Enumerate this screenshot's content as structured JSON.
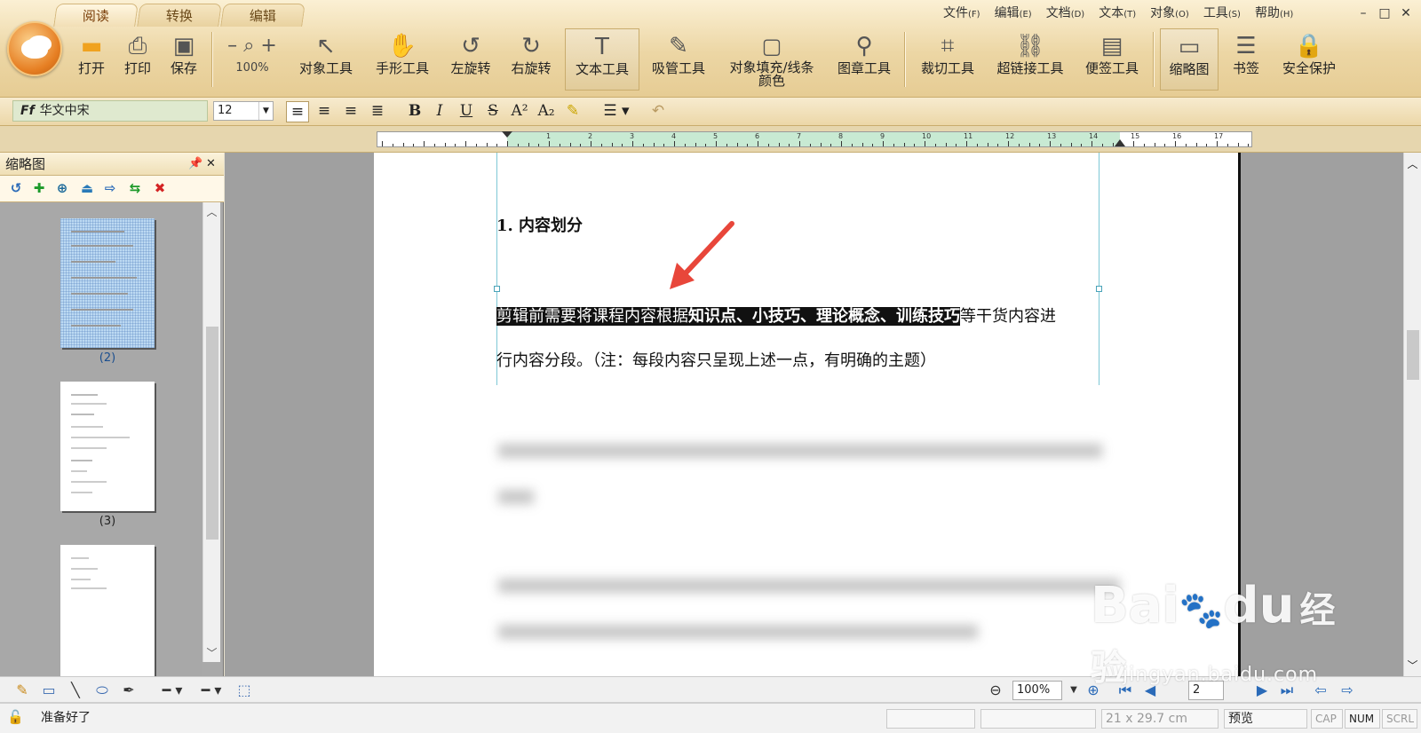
{
  "tabs": [
    "阅读",
    "转换",
    "编辑"
  ],
  "menus": [
    {
      "label": "文件",
      "key": "(F)"
    },
    {
      "label": "编辑",
      "key": "(E)"
    },
    {
      "label": "文档",
      "key": "(D)"
    },
    {
      "label": "文本",
      "key": "(T)"
    },
    {
      "label": "对象",
      "key": "(O)"
    },
    {
      "label": "工具",
      "key": "(S)"
    },
    {
      "label": "帮助",
      "key": "(H)"
    }
  ],
  "window_buttons": [
    "–",
    "□",
    "✕"
  ],
  "toolbar": {
    "open": "打开",
    "print": "打印",
    "save": "保存",
    "zoom_value": "100%",
    "object_tool": "对象工具",
    "hand_tool": "手形工具",
    "rotate_left": "左旋转",
    "rotate_right": "右旋转",
    "text_tool": "文本工具",
    "eyedropper": "吸管工具",
    "fill_line_1": "对象填充/线条",
    "fill_line_2": "颜色",
    "stamp_tool": "图章工具",
    "crop_tool": "裁切工具",
    "hyperlink_tool": "超链接工具",
    "note_tool": "便签工具",
    "thumbnails": "缩略图",
    "bookmarks": "书签",
    "security": "安全保护"
  },
  "format": {
    "font_name": "华文中宋",
    "font_size": "12"
  },
  "ruler_numbers": [
    "1",
    "2",
    "3",
    "4",
    "5",
    "6",
    "7",
    "8",
    "9",
    "10",
    "11",
    "12",
    "13",
    "14",
    "15",
    "16",
    "17"
  ],
  "panel": {
    "title": "缩略图",
    "pin": "ꟸ",
    "close": "✕",
    "thumb_labels": [
      "(2)",
      "(3)"
    ]
  },
  "document": {
    "heading": "1. 内容划分",
    "para1_pre": "剪辑前需要将课程内容根据",
    "para1_bold": "知识点、小技巧、理论概念、训练技巧",
    "para1_post": "等干货内容进",
    "para2": "行内容分段。（注：每段内容只呈现上述一点，有明确的主题）"
  },
  "bottom": {
    "zoom": "100%",
    "page": "2"
  },
  "status": {
    "ready": "准备好了",
    "page_size": "21 x 29.7 cm",
    "preview": "预览",
    "cap": "CAP",
    "num": "NUM",
    "scrl": "SCRL"
  },
  "watermark": {
    "brand": "Bai",
    "brand2": "du",
    "cn": "经验",
    "url": "jingyan.baidu.com"
  },
  "colors": {
    "ribbon": "#ecd6a4",
    "highlight": "#111111",
    "arrow": "#e8463a",
    "ruler_active": "#c8ead3"
  }
}
